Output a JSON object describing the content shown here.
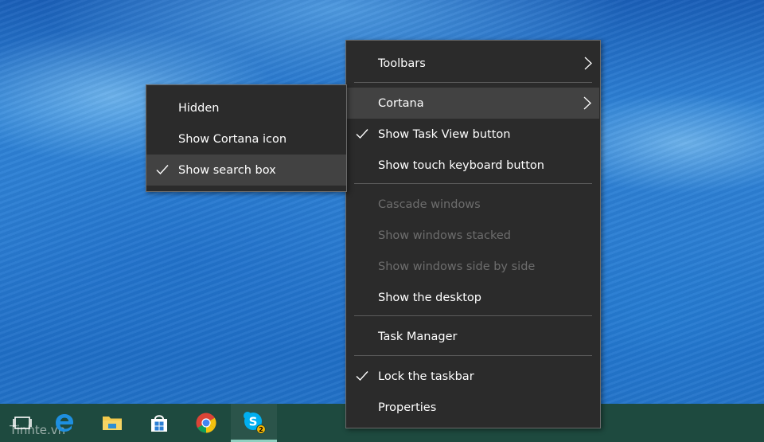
{
  "context_menu": {
    "items": [
      {
        "label": "Toolbars",
        "submenu": true
      },
      {
        "label": "Cortana",
        "submenu": true,
        "highlighted": true
      },
      {
        "label": "Show Task View button",
        "checked": true
      },
      {
        "label": "Show touch keyboard button"
      },
      {
        "label": "Cascade windows",
        "disabled": true
      },
      {
        "label": "Show windows stacked",
        "disabled": true
      },
      {
        "label": "Show windows side by side",
        "disabled": true
      },
      {
        "label": "Show the desktop"
      },
      {
        "label": "Task Manager"
      },
      {
        "label": "Lock the taskbar",
        "checked": true
      },
      {
        "label": "Properties"
      }
    ]
  },
  "cortana_submenu": {
    "items": [
      {
        "label": "Hidden"
      },
      {
        "label": "Show Cortana icon"
      },
      {
        "label": "Show search box",
        "checked": true,
        "highlighted": true
      }
    ]
  },
  "taskbar": {
    "apps": [
      {
        "icon": "task-view-icon"
      },
      {
        "icon": "edge-icon"
      },
      {
        "icon": "file-explorer-icon"
      },
      {
        "icon": "store-icon"
      },
      {
        "icon": "chrome-icon"
      },
      {
        "icon": "skype-icon",
        "badge": "2",
        "active": true
      }
    ]
  },
  "watermark": "Tinhte.vn",
  "colors": {
    "menu_bg": "#2b2b2b",
    "menu_highlight": "#424242",
    "menu_text": "#ffffff",
    "menu_disabled_text": "#6d6d6d",
    "taskbar_bg": "#1e4a3f"
  }
}
